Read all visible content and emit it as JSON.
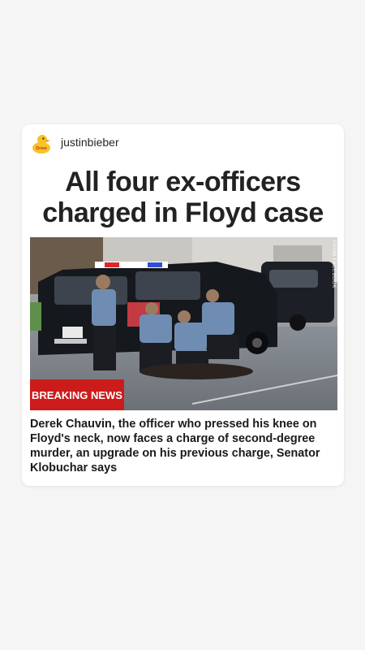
{
  "post": {
    "username": "justinbieber",
    "avatar_icon": "rubber-duck-icon",
    "avatar_text": "Drew"
  },
  "article": {
    "headline": "All four ex-officers charged in Floyd case",
    "badge": "BREAKING NEWS",
    "photo_credit": "FROM FACEBOOK",
    "body": "Derek Chauvin, the officer who pressed his knee on Floyd's neck, now faces a charge of second-degree murder, an upgrade on his previous charge, Senator Klobuchar says"
  },
  "colors": {
    "badge_bg": "#cc1b1b",
    "duck": "#f7c325",
    "card_bg": "#ffffff",
    "page_bg": "#f5f5f5"
  }
}
